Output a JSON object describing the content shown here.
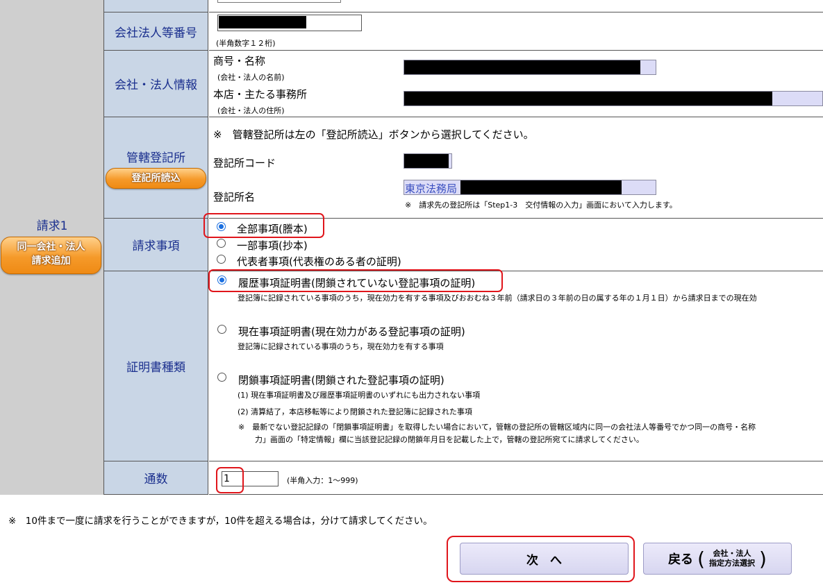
{
  "request": {
    "label": "請求1",
    "add_button": {
      "line1": "同一会社・法人",
      "line2": "請求追加"
    }
  },
  "corp_number": {
    "label": "会社法人等番号",
    "note": "(半角数字１２桁)"
  },
  "corp_info": {
    "label": "会社・法人情報",
    "name_label": "商号・名称",
    "name_note": "(会社・法人の名前)",
    "address_label": "本店・主たる事務所",
    "address_note": "(会社・法人の住所)"
  },
  "registry": {
    "label": "管轄登記所",
    "load_button": "登記所読込",
    "instruction": "※　管轄登記所は左の「登記所読込」ボタンから選択してください。",
    "code_label": "登記所コード",
    "name_label": "登記所名",
    "name_value": "東京法務局",
    "name_note": "※　請求先の登記所は「Step1-3　交付情報の入力」画面において入力します。"
  },
  "request_items": {
    "label": "請求事項",
    "options": [
      {
        "label": "全部事項(謄本)",
        "selected": true
      },
      {
        "label": "一部事項(抄本)",
        "selected": false
      },
      {
        "label": "代表者事項(代表権のある者の証明)",
        "selected": false
      }
    ]
  },
  "cert_type": {
    "label": "証明書種類",
    "options": [
      {
        "label": "履歴事項証明書(閉鎖されていない登記事項の証明)",
        "selected": true,
        "desc": "登記簿に記録されている事項のうち，現在効力を有する事項及びおおむね３年前（請求日の３年前の日の属する年の１月１日）から請求日までの現在効"
      },
      {
        "label": "現在事項証明書(現在効力がある登記事項の証明)",
        "selected": false,
        "desc": "登記簿に記録されている事項のうち，現在効力を有する事項"
      },
      {
        "label": "閉鎖事項証明書(閉鎖された登記事項の証明)",
        "selected": false,
        "desc1": "(1) 現在事項証明書及び履歴事項証明書のいずれにも出力されない事項",
        "desc2": "(2) 清算結了，本店移転等により閉鎖された登記簿に記録された事項",
        "desc3": "※　最新でない登記記録の「閉鎖事項証明書」を取得したい場合において，管轄の登記所の管轄区域内に同一の会社法人等番号でかつ同一の商号・名称",
        "desc4": "力」画面の「特定情報」欄に当該登記記録の閉鎖年月日を記載した上で，管轄の登記所宛てに請求してください。"
      }
    ]
  },
  "copies": {
    "label": "通数",
    "value": "1",
    "note": "(半角入力：1〜999)"
  },
  "footer_note": "※　10件まで一度に請求を行うことができますが，10件を超える場合は，分けて請求してください。",
  "buttons": {
    "next": "次　へ",
    "back": "戻る",
    "back_sub1": "会社・法人",
    "back_sub2": "指定方法選択"
  }
}
